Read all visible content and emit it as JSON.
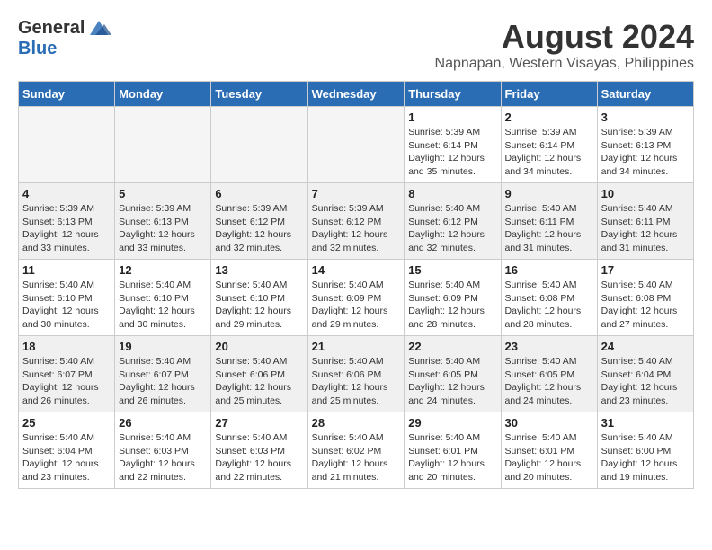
{
  "header": {
    "logo_general": "General",
    "logo_blue": "Blue",
    "month_title": "August 2024",
    "location": "Napnapan, Western Visayas, Philippines"
  },
  "days_of_week": [
    "Sunday",
    "Monday",
    "Tuesday",
    "Wednesday",
    "Thursday",
    "Friday",
    "Saturday"
  ],
  "weeks": [
    [
      {
        "day": "",
        "info": ""
      },
      {
        "day": "",
        "info": ""
      },
      {
        "day": "",
        "info": ""
      },
      {
        "day": "",
        "info": ""
      },
      {
        "day": "1",
        "info": "Sunrise: 5:39 AM\nSunset: 6:14 PM\nDaylight: 12 hours\nand 35 minutes."
      },
      {
        "day": "2",
        "info": "Sunrise: 5:39 AM\nSunset: 6:14 PM\nDaylight: 12 hours\nand 34 minutes."
      },
      {
        "day": "3",
        "info": "Sunrise: 5:39 AM\nSunset: 6:13 PM\nDaylight: 12 hours\nand 34 minutes."
      }
    ],
    [
      {
        "day": "4",
        "info": "Sunrise: 5:39 AM\nSunset: 6:13 PM\nDaylight: 12 hours\nand 33 minutes."
      },
      {
        "day": "5",
        "info": "Sunrise: 5:39 AM\nSunset: 6:13 PM\nDaylight: 12 hours\nand 33 minutes."
      },
      {
        "day": "6",
        "info": "Sunrise: 5:39 AM\nSunset: 6:12 PM\nDaylight: 12 hours\nand 32 minutes."
      },
      {
        "day": "7",
        "info": "Sunrise: 5:39 AM\nSunset: 6:12 PM\nDaylight: 12 hours\nand 32 minutes."
      },
      {
        "day": "8",
        "info": "Sunrise: 5:40 AM\nSunset: 6:12 PM\nDaylight: 12 hours\nand 32 minutes."
      },
      {
        "day": "9",
        "info": "Sunrise: 5:40 AM\nSunset: 6:11 PM\nDaylight: 12 hours\nand 31 minutes."
      },
      {
        "day": "10",
        "info": "Sunrise: 5:40 AM\nSunset: 6:11 PM\nDaylight: 12 hours\nand 31 minutes."
      }
    ],
    [
      {
        "day": "11",
        "info": "Sunrise: 5:40 AM\nSunset: 6:10 PM\nDaylight: 12 hours\nand 30 minutes."
      },
      {
        "day": "12",
        "info": "Sunrise: 5:40 AM\nSunset: 6:10 PM\nDaylight: 12 hours\nand 30 minutes."
      },
      {
        "day": "13",
        "info": "Sunrise: 5:40 AM\nSunset: 6:10 PM\nDaylight: 12 hours\nand 29 minutes."
      },
      {
        "day": "14",
        "info": "Sunrise: 5:40 AM\nSunset: 6:09 PM\nDaylight: 12 hours\nand 29 minutes."
      },
      {
        "day": "15",
        "info": "Sunrise: 5:40 AM\nSunset: 6:09 PM\nDaylight: 12 hours\nand 28 minutes."
      },
      {
        "day": "16",
        "info": "Sunrise: 5:40 AM\nSunset: 6:08 PM\nDaylight: 12 hours\nand 28 minutes."
      },
      {
        "day": "17",
        "info": "Sunrise: 5:40 AM\nSunset: 6:08 PM\nDaylight: 12 hours\nand 27 minutes."
      }
    ],
    [
      {
        "day": "18",
        "info": "Sunrise: 5:40 AM\nSunset: 6:07 PM\nDaylight: 12 hours\nand 26 minutes."
      },
      {
        "day": "19",
        "info": "Sunrise: 5:40 AM\nSunset: 6:07 PM\nDaylight: 12 hours\nand 26 minutes."
      },
      {
        "day": "20",
        "info": "Sunrise: 5:40 AM\nSunset: 6:06 PM\nDaylight: 12 hours\nand 25 minutes."
      },
      {
        "day": "21",
        "info": "Sunrise: 5:40 AM\nSunset: 6:06 PM\nDaylight: 12 hours\nand 25 minutes."
      },
      {
        "day": "22",
        "info": "Sunrise: 5:40 AM\nSunset: 6:05 PM\nDaylight: 12 hours\nand 24 minutes."
      },
      {
        "day": "23",
        "info": "Sunrise: 5:40 AM\nSunset: 6:05 PM\nDaylight: 12 hours\nand 24 minutes."
      },
      {
        "day": "24",
        "info": "Sunrise: 5:40 AM\nSunset: 6:04 PM\nDaylight: 12 hours\nand 23 minutes."
      }
    ],
    [
      {
        "day": "25",
        "info": "Sunrise: 5:40 AM\nSunset: 6:04 PM\nDaylight: 12 hours\nand 23 minutes."
      },
      {
        "day": "26",
        "info": "Sunrise: 5:40 AM\nSunset: 6:03 PM\nDaylight: 12 hours\nand 22 minutes."
      },
      {
        "day": "27",
        "info": "Sunrise: 5:40 AM\nSunset: 6:03 PM\nDaylight: 12 hours\nand 22 minutes."
      },
      {
        "day": "28",
        "info": "Sunrise: 5:40 AM\nSunset: 6:02 PM\nDaylight: 12 hours\nand 21 minutes."
      },
      {
        "day": "29",
        "info": "Sunrise: 5:40 AM\nSunset: 6:01 PM\nDaylight: 12 hours\nand 20 minutes."
      },
      {
        "day": "30",
        "info": "Sunrise: 5:40 AM\nSunset: 6:01 PM\nDaylight: 12 hours\nand 20 minutes."
      },
      {
        "day": "31",
        "info": "Sunrise: 5:40 AM\nSunset: 6:00 PM\nDaylight: 12 hours\nand 19 minutes."
      }
    ]
  ]
}
